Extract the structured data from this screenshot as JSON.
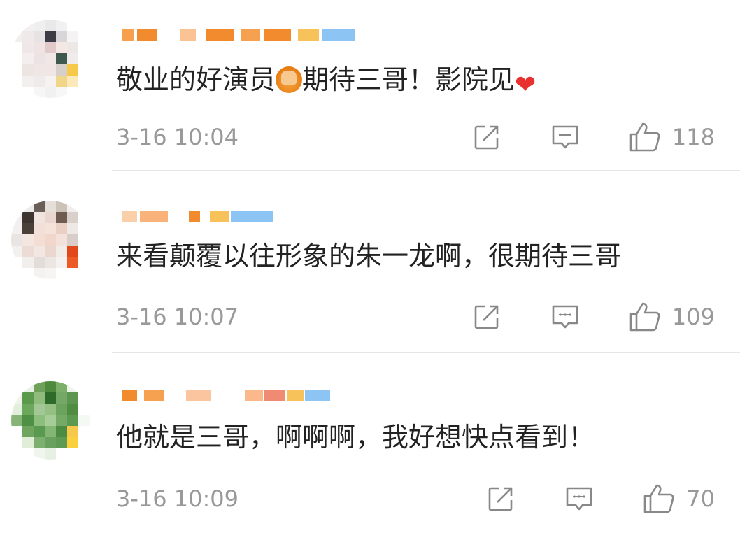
{
  "comments": [
    {
      "text_parts": [
        "敬业的好演员",
        "期待三哥！影院见",
        ""
      ],
      "time": "3-16 10:04",
      "likes": "118",
      "emojis": [
        "hands-clap",
        "red-heart"
      ]
    },
    {
      "text": "来看颠覆以往形象的朱一龙啊，很期待三哥",
      "time": "3-16 10:07",
      "likes": "109"
    },
    {
      "text": "他就是三哥，啊啊啊，我好想快点看到！",
      "time": "3-16 10:09",
      "likes": "70"
    }
  ],
  "icons": {
    "share": "share-icon",
    "reply": "comment-icon",
    "like": "thumbs-up-icon"
  },
  "colors": {
    "text": "#222222",
    "meta": "#999999",
    "divider": "#e6e6e6",
    "username_orange": "#f28a2e",
    "username_blue": "#6db0f0"
  }
}
